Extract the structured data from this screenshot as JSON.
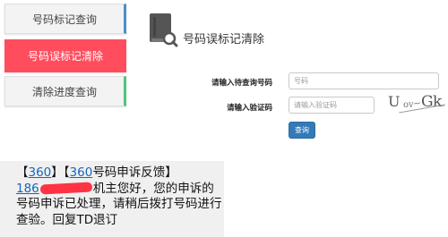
{
  "sidebar": {
    "items": [
      {
        "label": "号码标记查询"
      },
      {
        "label": "号码误标记清除"
      },
      {
        "label": "清除进度查询"
      }
    ]
  },
  "panel": {
    "title": "号码误标记清除"
  },
  "form": {
    "phone_label": "请输入待查询号码",
    "phone_placeholder": "号码",
    "code_label": "请输入验证码",
    "code_placeholder": "请输入验证码",
    "captcha": [
      "U",
      "ov",
      "~",
      "G",
      "k",
      ","
    ],
    "query_button": "查询"
  },
  "sms": {
    "line1_open": "【",
    "line1_link1": "360",
    "line1_mid": "】【",
    "line1_link2": "360",
    "line1_tail": "号码申诉反馈】",
    "line2_prefix": "186",
    "line2_tail": "机主您好，您的申诉的",
    "line3": "号码申诉已处理，请稍后拨打号码进行",
    "line4": "查验。回复TD退订"
  },
  "colors": {
    "active_nav": "#ff4d5e",
    "primary_button": "#337ab7",
    "link": "#1565c0",
    "redaction": "#ff3344"
  }
}
